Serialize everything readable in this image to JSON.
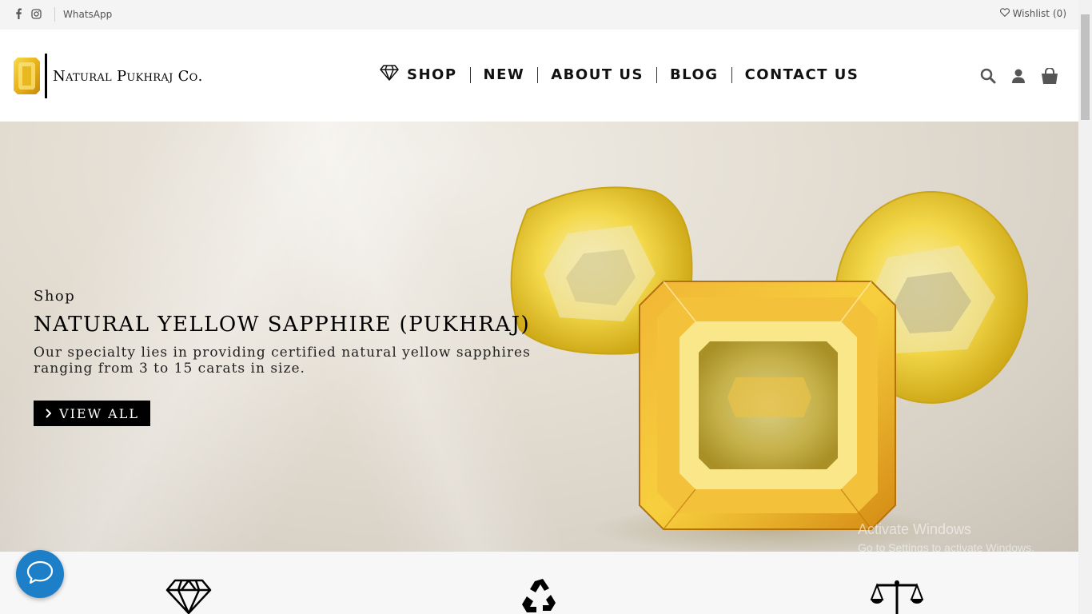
{
  "topbar": {
    "social_icons": [
      "facebook-icon",
      "instagram-icon"
    ],
    "whatsapp_label": "WhatsApp",
    "wishlist_label": "Wishlist",
    "wishlist_count": "0"
  },
  "header": {
    "brand_name": "Natural Pukhraj Co.",
    "nav": [
      {
        "label": "SHOP",
        "icon": "diamond-icon"
      },
      {
        "label": "NEW"
      },
      {
        "label": "ABOUT US"
      },
      {
        "label": "BLOG"
      },
      {
        "label": "CONTACT US"
      }
    ],
    "icons": [
      "search-icon",
      "user-icon",
      "cart-icon"
    ]
  },
  "hero": {
    "kicker": "Shop",
    "title": "NATURAL YELLOW SAPPHIRE (PUKHRAJ)",
    "description": "Our specialty lies in providing certified natural yellow sapphires ranging from 3 to 15 carats in size.",
    "button_label": "VIEW ALL",
    "button_icon": "chevron-right-icon"
  },
  "watermark": {
    "line1": "Activate Windows",
    "line2": "Go to Settings to activate Windows."
  },
  "features": {
    "icons": [
      "diamond-outline-icon",
      "recycle-icon",
      "scales-icon"
    ]
  },
  "chat": {
    "icon": "chat-bubble-icon"
  },
  "colors": {
    "accent": "#1c7fc7",
    "gem_yellow": "#f2c829"
  }
}
